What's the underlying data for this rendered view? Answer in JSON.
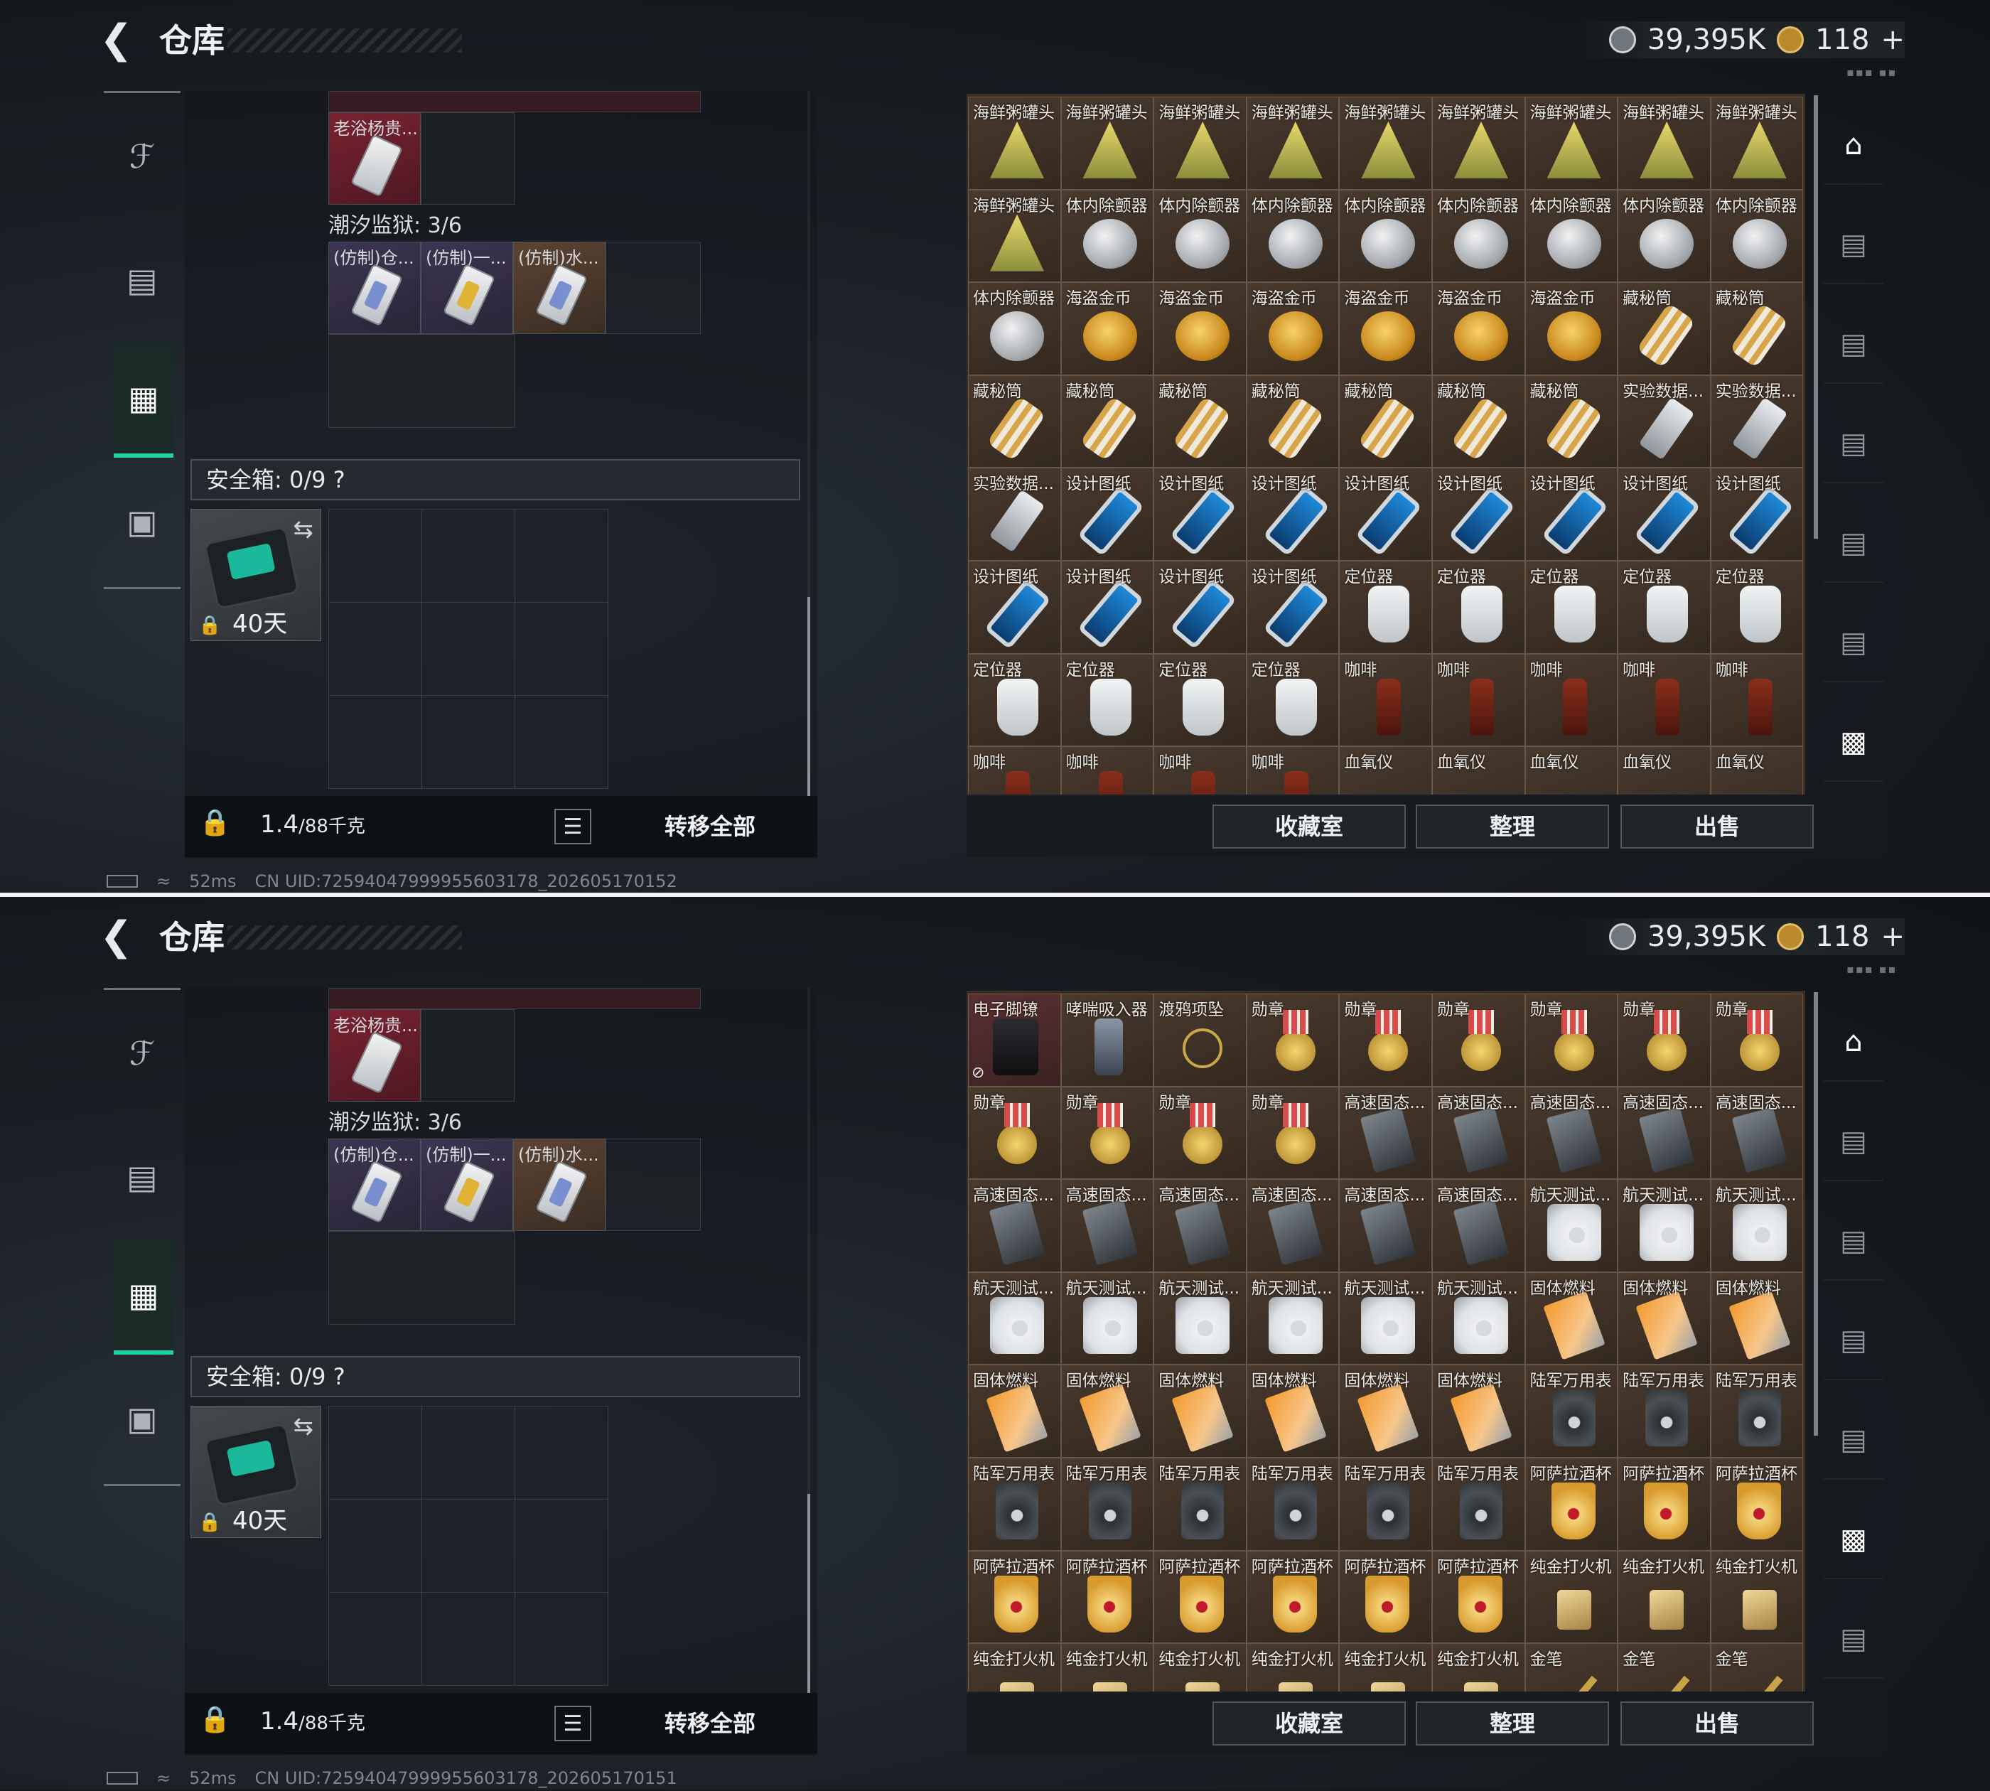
{
  "screens": [
    {
      "header": {
        "title": "仓库",
        "silver": "39,395K",
        "gold": "118",
        "gold_plus": "+"
      },
      "left": {
        "top_item": "老浴杨贵...",
        "prison_label": "潮汐监狱: 3/6",
        "prison_items": [
          "(仿制)仓...",
          "(仿制)一...",
          "(仿制)水..."
        ],
        "safebox_label": "安全箱: 0/9",
        "safebox_help": "?",
        "case_days": "40天",
        "weight_value": "1.4",
        "weight_max": "/88千克",
        "transfer_all": "转移全部"
      },
      "right": {
        "items": [
          "海鲜粥罐头",
          "海鲜粥罐头",
          "海鲜粥罐头",
          "海鲜粥罐头",
          "海鲜粥罐头",
          "海鲜粥罐头",
          "海鲜粥罐头",
          "海鲜粥罐头",
          "海鲜粥罐头",
          "海鲜粥罐头",
          "体内除颤器",
          "体内除颤器",
          "体内除颤器",
          "体内除颤器",
          "体内除颤器",
          "体内除颤器",
          "体内除颤器",
          "体内除颤器",
          "体内除颤器",
          "海盗金币",
          "海盗金币",
          "海盗金币",
          "海盗金币",
          "海盗金币",
          "海盗金币",
          "藏秘筒",
          "藏秘筒",
          "藏秘筒",
          "藏秘筒",
          "藏秘筒",
          "藏秘筒",
          "藏秘筒",
          "藏秘筒",
          "藏秘筒",
          "实验数据...",
          "实验数据...",
          "实验数据...",
          "设计图纸",
          "设计图纸",
          "设计图纸",
          "设计图纸",
          "设计图纸",
          "设计图纸",
          "设计图纸",
          "设计图纸",
          "设计图纸",
          "设计图纸",
          "设计图纸",
          "设计图纸",
          "定位器",
          "定位器",
          "定位器",
          "定位器",
          "定位器",
          "定位器",
          "定位器",
          "定位器",
          "定位器",
          "咖啡",
          "咖啡",
          "咖啡",
          "咖啡",
          "咖啡",
          "咖啡",
          "咖啡",
          "咖啡",
          "咖啡",
          "血氧仪",
          "血氧仪",
          "血氧仪",
          "血氧仪",
          "血氧仪"
        ],
        "btn_collection": "收藏室",
        "btn_sort": "整理",
        "btn_sell": "出售"
      },
      "footer": {
        "ping": "52ms",
        "uid": "CN UID:7259404799995560317​8_202605170152"
      }
    },
    {
      "header": {
        "title": "仓库",
        "silver": "39,395K",
        "gold": "118",
        "gold_plus": "+"
      },
      "left": {
        "top_item": "老浴杨贵...",
        "prison_label": "潮汐监狱: 3/6",
        "prison_items": [
          "(仿制)仓...",
          "(仿制)一...",
          "(仿制)水..."
        ],
        "safebox_label": "安全箱: 0/9",
        "safebox_help": "?",
        "case_days": "40天",
        "weight_value": "1.4",
        "weight_max": "/88千克",
        "transfer_all": "转移全部"
      },
      "right": {
        "items": [
          "电子脚镣",
          "哮喘吸入器",
          "渡鸦项坠",
          "勋章",
          "勋章",
          "勋章",
          "勋章",
          "勋章",
          "勋章",
          "勋章",
          "勋章",
          "勋章",
          "勋章",
          "高速固态...",
          "高速固态...",
          "高速固态...",
          "高速固态...",
          "高速固态...",
          "高速固态...",
          "高速固态...",
          "高速固态...",
          "高速固态...",
          "高速固态...",
          "高速固态...",
          "航天测试...",
          "航天测试...",
          "航天测试...",
          "航天测试...",
          "航天测试...",
          "航天测试...",
          "航天测试...",
          "航天测试...",
          "航天测试...",
          "固体燃料",
          "固体燃料",
          "固体燃料",
          "固体燃料",
          "固体燃料",
          "固体燃料",
          "固体燃料",
          "固体燃料",
          "固体燃料",
          "陆军万用表",
          "陆军万用表",
          "陆军万用表",
          "陆军万用表",
          "陆军万用表",
          "陆军万用表",
          "陆军万用表",
          "陆军万用表",
          "陆军万用表",
          "阿萨拉酒杯",
          "阿萨拉酒杯",
          "阿萨拉酒杯",
          "阿萨拉酒杯",
          "阿萨拉酒杯",
          "阿萨拉酒杯",
          "阿萨拉酒杯",
          "阿萨拉酒杯",
          "阿萨拉酒杯",
          "纯金打火机",
          "纯金打火机",
          "纯金打火机",
          "纯金打火机",
          "纯金打火机",
          "纯金打火机",
          "纯金打火机",
          "纯金打火机",
          "纯金打火机",
          "金笔",
          "金笔",
          "金笔"
        ],
        "btn_collection": "收藏室",
        "btn_sort": "整理",
        "btn_sell": "出售"
      },
      "footer": {
        "ping": "52ms",
        "uid": "CN UID:72594047999955603178_202605170151"
      }
    }
  ],
  "icons": {
    "s1": [
      "can",
      "can",
      "can",
      "can",
      "can",
      "can",
      "can",
      "can",
      "can",
      "can",
      "disc",
      "disc",
      "disc",
      "disc",
      "disc",
      "disc",
      "disc",
      "disc",
      "disc",
      "coin",
      "coin",
      "coin",
      "coin",
      "coin",
      "coin",
      "tube",
      "tube",
      "tube",
      "tube",
      "tube",
      "tube",
      "tube",
      "tube",
      "tube",
      "usb",
      "usb",
      "usb",
      "blue",
      "blue",
      "blue",
      "blue",
      "blue",
      "blue",
      "blue",
      "blue",
      "blue",
      "blue",
      "blue",
      "blue",
      "tag",
      "tag",
      "tag",
      "tag",
      "tag",
      "tag",
      "tag",
      "tag",
      "tag",
      "bottle",
      "bottle",
      "bottle",
      "bottle",
      "bottle",
      "bottle",
      "bottle",
      "bottle",
      "bottle",
      "oxi",
      "oxi",
      "oxi",
      "oxi",
      "oxi"
    ],
    "s2": [
      "shackle",
      "inhaler",
      "pendant",
      "medal",
      "medal",
      "medal",
      "medal",
      "medal",
      "medal",
      "medal",
      "medal",
      "medal",
      "medal",
      "ssd",
      "ssd",
      "ssd",
      "ssd",
      "ssd",
      "ssd",
      "ssd",
      "ssd",
      "ssd",
      "ssd",
      "ssd",
      "hdd",
      "hdd",
      "hdd",
      "hdd",
      "hdd",
      "hdd",
      "hdd",
      "hdd",
      "hdd",
      "fuel",
      "fuel",
      "fuel",
      "fuel",
      "fuel",
      "fuel",
      "fuel",
      "fuel",
      "fuel",
      "meter",
      "meter",
      "meter",
      "meter",
      "meter",
      "meter",
      "meter",
      "meter",
      "meter",
      "cup",
      "cup",
      "cup",
      "cup",
      "cup",
      "cup",
      "cup",
      "cup",
      "cup",
      "lighter",
      "lighter",
      "lighter",
      "lighter",
      "lighter",
      "lighter",
      "lighter",
      "lighter",
      "lighter",
      "pen",
      "pen",
      "pen"
    ]
  },
  "colors": {
    "accent": "#1ed1a4",
    "stash_bg": "#3b2e24",
    "red_slot": "#7a2230"
  }
}
